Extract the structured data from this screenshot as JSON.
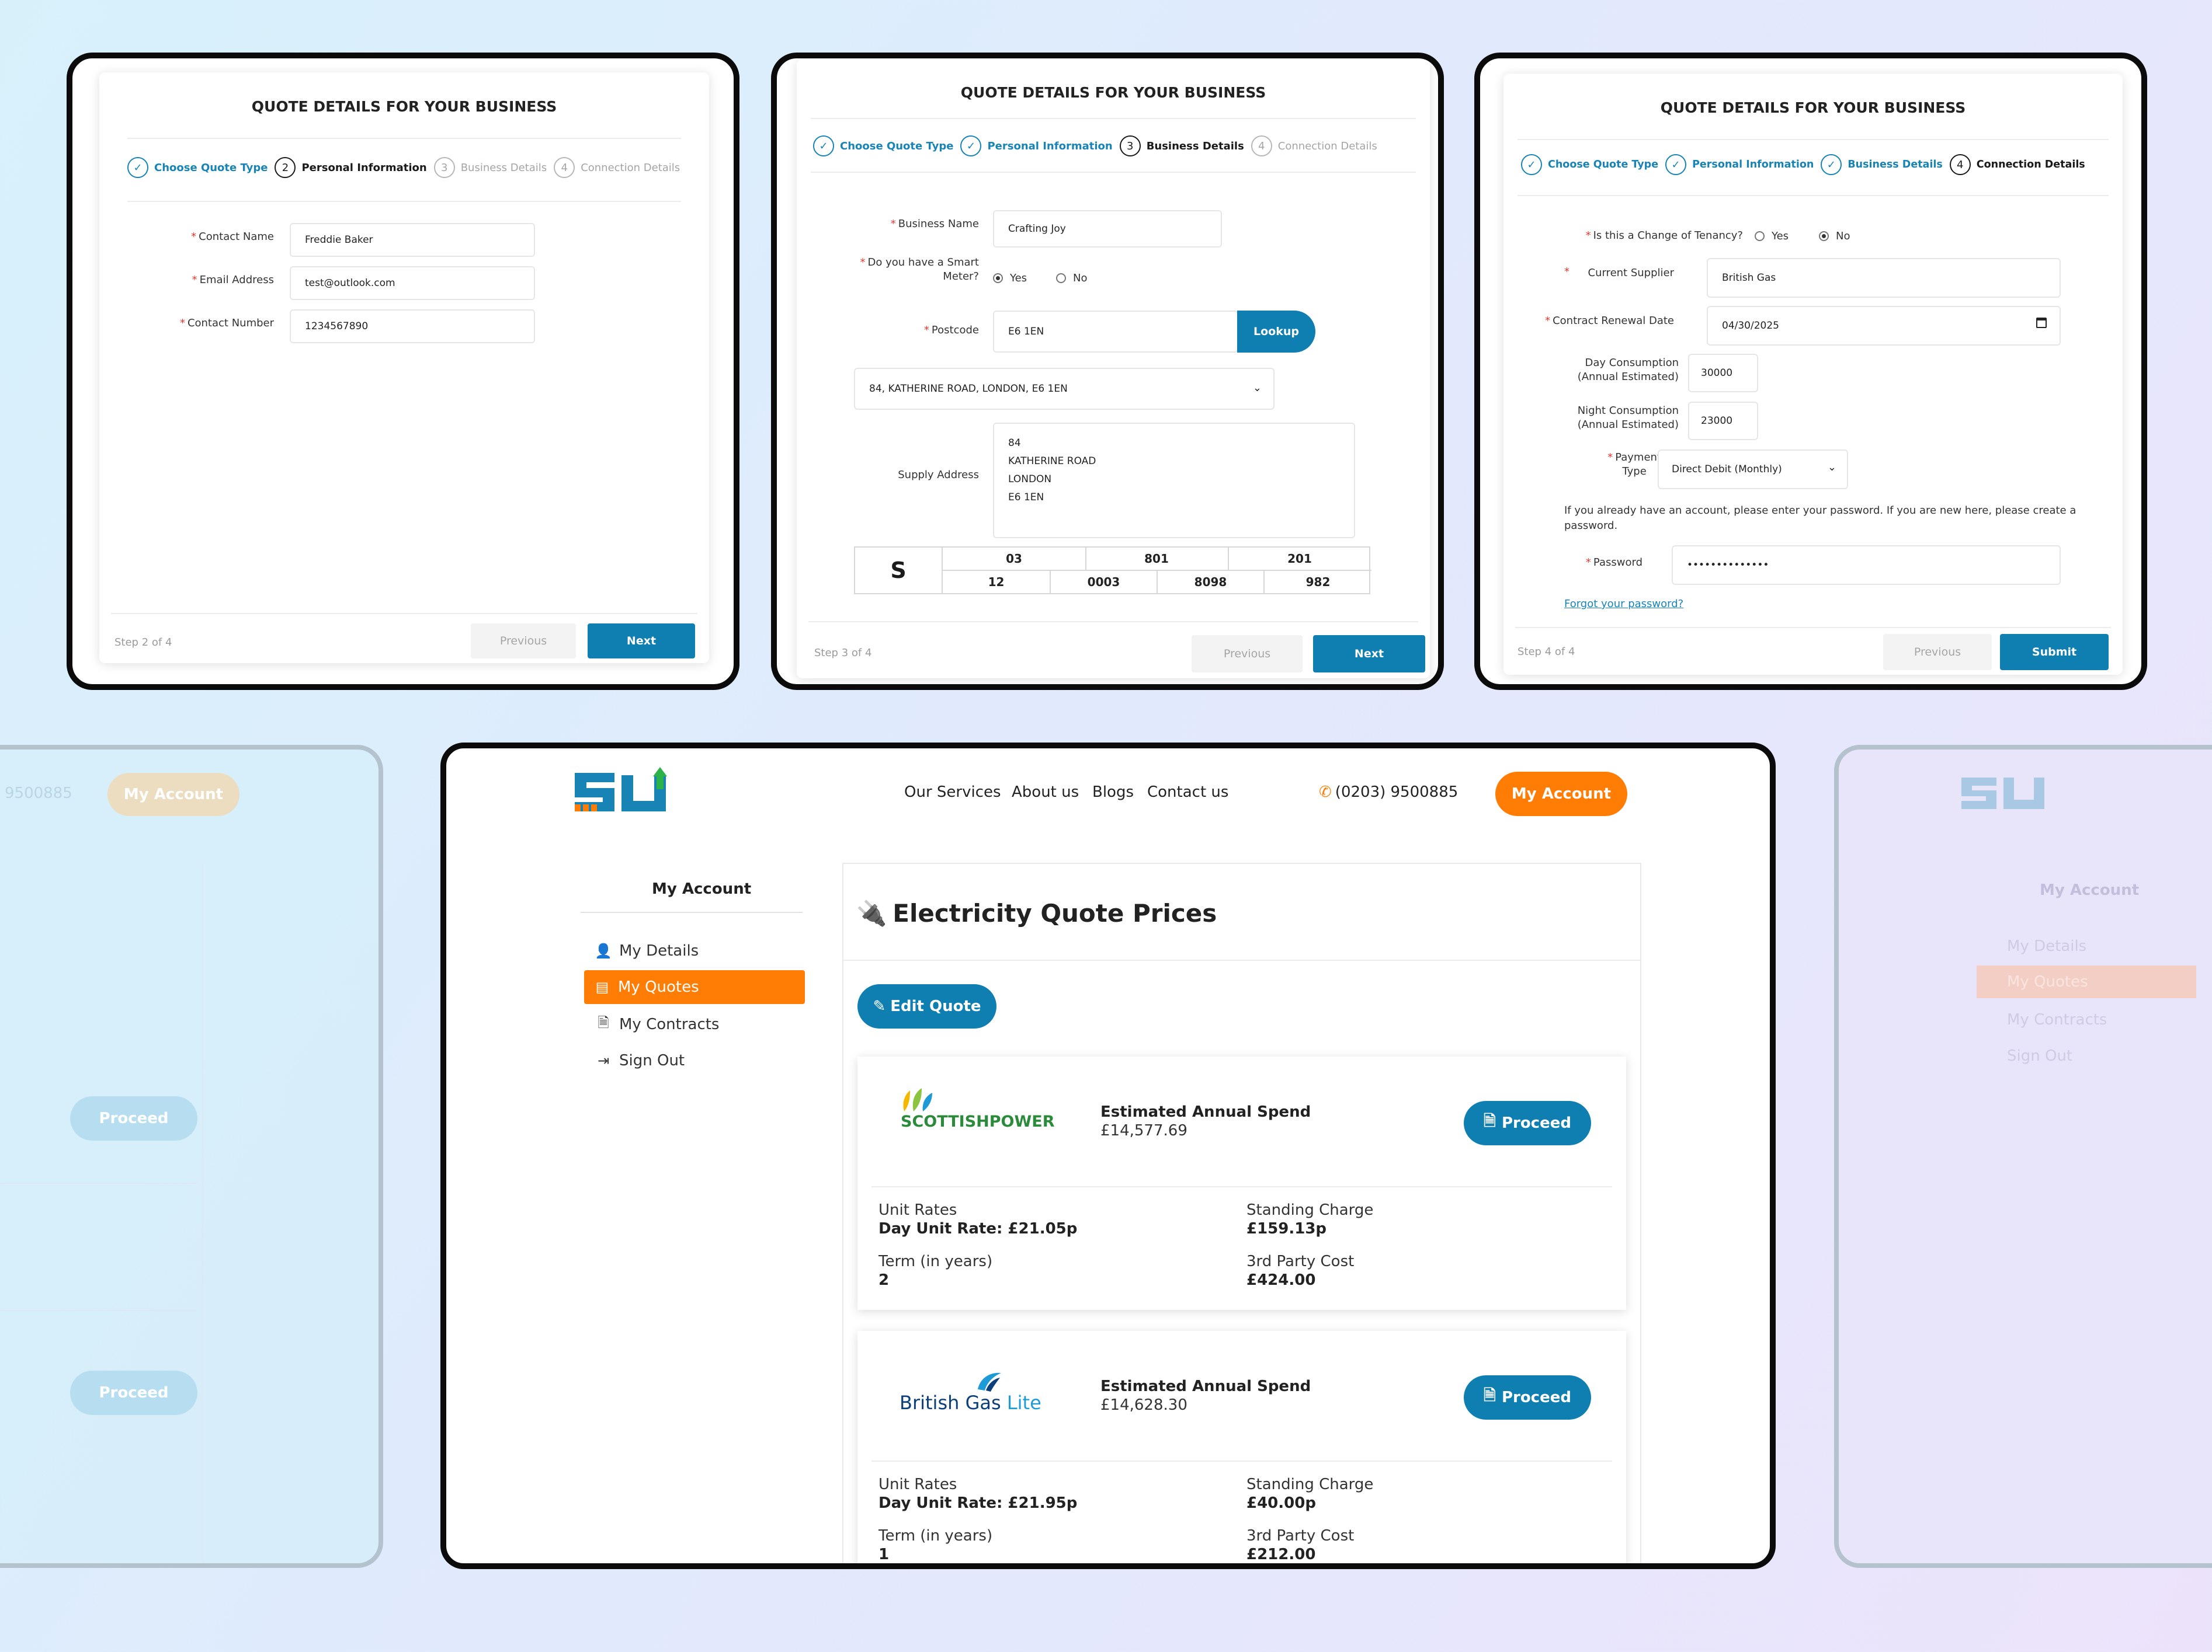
{
  "quote_form": {
    "title": "QUOTE DETAILS FOR YOUR BUSINESS",
    "steps": [
      "Choose Quote Type",
      "Personal Information",
      "Business Details",
      "Connection Details"
    ],
    "step_numbers": [
      "2",
      "3",
      "4"
    ],
    "check": "✓",
    "previous_label": "Previous",
    "next_label": "Next",
    "submit_label": "Submit"
  },
  "panel1": {
    "labels": {
      "contact_name": "Contact Name",
      "email": "Email Address",
      "phone": "Contact Number"
    },
    "values": {
      "contact_name": "Freddie Baker",
      "email": "test@outlook.com",
      "phone": "1234567890"
    },
    "footer": "Step 2 of 4"
  },
  "panel2": {
    "labels": {
      "business_name": "Business Name",
      "smart_meter_1": "Do you have a Smart",
      "smart_meter_2": "Meter?",
      "postcode": "Postcode",
      "supply_address": "Supply Address"
    },
    "values": {
      "business_name": "Crafting Joy",
      "postcode": "E6 1EN",
      "address_select": "84, KATHERINE ROAD, LONDON, E6 1EN",
      "supply_address": [
        "84",
        "KATHERINE ROAD",
        "LONDON",
        "E6 1EN"
      ]
    },
    "radio": {
      "yes": "Yes",
      "no": "No"
    },
    "lookup_label": "Lookup",
    "mpan": {
      "prefix": "S",
      "top": [
        "03",
        "801",
        "201"
      ],
      "bottom": [
        "12",
        "0003",
        "8098",
        "982"
      ]
    },
    "footer": "Step 3 of 4"
  },
  "panel3": {
    "labels": {
      "tenancy": "Is this a Change of Tenancy?",
      "supplier": "Current Supplier",
      "renewal": "Contract Renewal Date",
      "day_1": "Day Consumption",
      "day_2": "(Annual Estimated)",
      "night_1": "Night Consumption",
      "night_2": "(Annual Estimated)",
      "payment_1": "Payment",
      "payment_2": "Type",
      "password": "Password"
    },
    "values": {
      "supplier": "British Gas",
      "renewal": "04/30/2025",
      "day": "30000",
      "night": "23000",
      "payment": "Direct Debit (Monthly)",
      "password": "••••••••••••••"
    },
    "radio": {
      "yes": "Yes",
      "no": "No"
    },
    "note_1": "If you already have an account, please enter your password. If you are new here, please create a",
    "note_2": "password.",
    "forgot": "Forgot your password?",
    "footer": "Step 4 of 4"
  },
  "site": {
    "nav": [
      "Our Services",
      "About us",
      "Blogs",
      "Contact us"
    ],
    "phone": "(0203) 9500885",
    "phone_ghost": "9500885",
    "account_button": "My Account"
  },
  "sidebar": {
    "title": "My Account",
    "items": [
      {
        "label": "My Details",
        "icon": "user-icon"
      },
      {
        "label": "My Quotes",
        "icon": "list-icon"
      },
      {
        "label": "My Contracts",
        "icon": "document-icon"
      },
      {
        "label": "Sign Out",
        "icon": "sign-out-icon"
      }
    ]
  },
  "quotes_page": {
    "title": "Electricity Quote Prices",
    "edit_label": "Edit Quote",
    "proceed_label": "Proceed",
    "cards": [
      {
        "supplier": "SCOTTISHPOWER",
        "spend_label": "Estimated Annual Spend",
        "spend_value": "£14,577.69",
        "unit_rates_label": "Unit Rates",
        "unit_rates_value": "Day Unit Rate: £21.05p",
        "standing_label": "Standing Charge",
        "standing_value": "£159.13p",
        "term_label": "Term (in years)",
        "term_value": "2",
        "third_label": "3rd Party Cost",
        "third_value": "£424.00"
      },
      {
        "supplier_a": "British Gas",
        "supplier_b": "Lite",
        "spend_label": "Estimated Annual Spend",
        "spend_value": "£14,628.30",
        "unit_rates_label": "Unit Rates",
        "unit_rates_value": "Day Unit Rate: £21.95p",
        "standing_label": "Standing Charge",
        "standing_value": "£40.00p",
        "term_label": "Term (in years)",
        "term_value": "1",
        "third_label": "3rd Party Cost",
        "third_value": "£212.00"
      }
    ]
  },
  "colors": {
    "accent_blue": "#0f7fb1",
    "accent_orange": "#ff7d05",
    "brand_green": "#2bb34a"
  }
}
